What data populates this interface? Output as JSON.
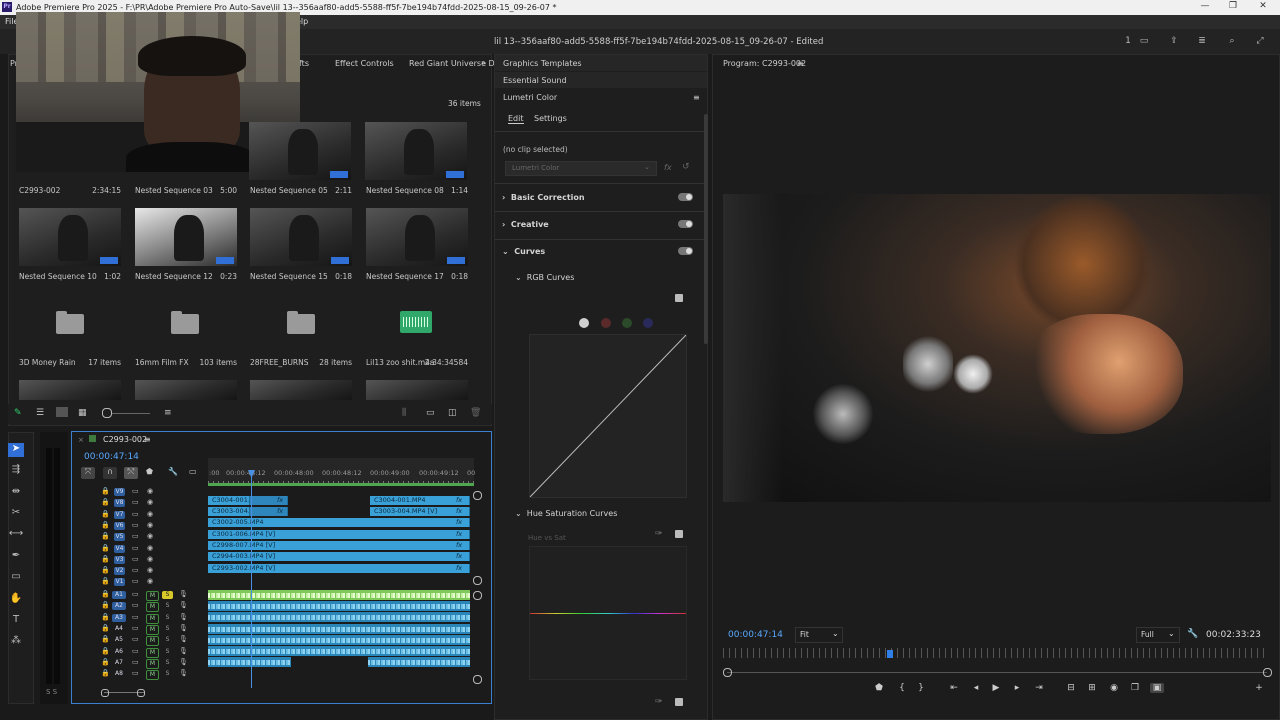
{
  "titlebar": {
    "logo": "Pr",
    "title": "Adobe Premiere Pro 2025 - F:\\PR\\Adobe Premiere Pro Auto-Save\\lil 13--356aaf80-add5-5588-ff5f-7be194b74fdd-2025-08-15_09-26-07 *",
    "minimize": "—",
    "maximize": "❐",
    "close": "✕"
  },
  "menubar": {
    "file": "File",
    "help": "elp"
  },
  "header": {
    "project_title": "lil 13--356aaf80-add5-5588-ff5f-7be194b74fdd-2025-08-15_09-26-07 - Edited",
    "count": "1"
  },
  "project_panel": {
    "tabs": [
      "Pr",
      "fts",
      "Effect Controls",
      "Red Giant Universe D"
    ],
    "tab_more": "»",
    "item_count": "36 items",
    "items": [
      {
        "name": "C2993-002",
        "meta": "2:34:15"
      },
      {
        "name": "Nested Sequence 03",
        "meta": "5:00"
      },
      {
        "name": "Nested Sequence 05",
        "meta": "2:11"
      },
      {
        "name": "Nested Sequence 08",
        "meta": "1:14"
      },
      {
        "name": "Nested Sequence 10",
        "meta": "1:02"
      },
      {
        "name": "Nested Sequence 12",
        "meta": "0:23"
      },
      {
        "name": "Nested Sequence 15",
        "meta": "0:18"
      },
      {
        "name": "Nested Sequence 17",
        "meta": "0:18"
      },
      {
        "name": "3D Money Rain",
        "meta": "17 items"
      },
      {
        "name": "16mm Film FX",
        "meta": "103 items"
      },
      {
        "name": "28FREE_BURNS",
        "meta": "28 items"
      },
      {
        "name": "Lil13 zoo shit.m4a",
        "meta": "2:34:34584"
      }
    ]
  },
  "lumetri": {
    "tabs": [
      "Graphics Templates",
      "Essential Sound",
      "Lumetri Color"
    ],
    "menu": "≡",
    "subtabs": [
      "Edit",
      "Settings"
    ],
    "no_clip": "(no clip selected)",
    "dropdown": "Lumetri Color",
    "fx": "fx",
    "sections": [
      "Basic Correction",
      "Creative",
      "Curves"
    ],
    "rgb_curves": "RGB Curves",
    "hue_sat_curves": "Hue Saturation Curves",
    "hue_vs_sat": "Hue vs Sat"
  },
  "program_monitor": {
    "title": "Program: C2993-002",
    "menu": "≡",
    "timecode": "00:00:47:14",
    "fit": "Fit",
    "quality": "Full",
    "duration": "00:02:33:23"
  },
  "timeline": {
    "sequence": "C2993-002",
    "menu": "≡",
    "timecode": "00:00:47:14",
    "ruler": [
      ":00",
      "00:00:48:12",
      "00:00:48:00",
      "00:00:48:12",
      "00:00:49:00",
      "00:00:49:12",
      "00"
    ],
    "video_tracks": [
      "V9",
      "V8",
      "V7",
      "V6",
      "V5",
      "V4",
      "V3",
      "V2",
      "V1"
    ],
    "audio_tracks": [
      "A1",
      "A2",
      "A3",
      "A4",
      "A5",
      "A6",
      "A7",
      "A8"
    ],
    "mute": "M",
    "solo": "S",
    "clips": [
      {
        "label": "C3004-001.",
        "fx": "fx"
      },
      {
        "label": "C3004-001.MP4",
        "fx": "fx"
      },
      {
        "label": "C3003-004.",
        "fx": "fx"
      },
      {
        "label": "C3003-004.MP4 [V]",
        "fx": "fx"
      },
      {
        "label": "C3002-005.MP4",
        "fx": "fx"
      },
      {
        "label": "C3001-006.MP4 [V]",
        "fx": "fx"
      },
      {
        "label": "C2998-007.MP4 [V]",
        "fx": "fx"
      },
      {
        "label": "C2994-003.MP4 [V]",
        "fx": "fx"
      },
      {
        "label": "C2993-002.MP4 [V]",
        "fx": "fx"
      }
    ]
  },
  "meter": {
    "label": "S S"
  }
}
